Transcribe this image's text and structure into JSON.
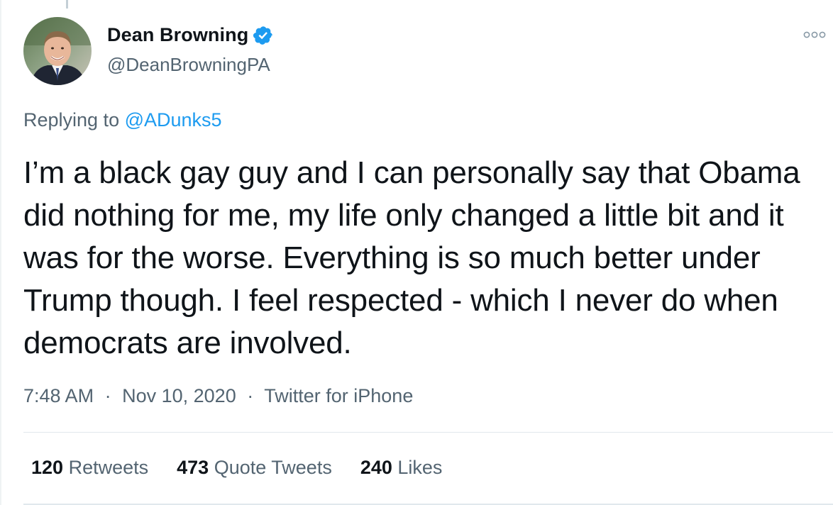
{
  "author": {
    "display_name": "Dean Browning",
    "handle": "@DeanBrowningPA",
    "verified": true,
    "avatar_icon": "profile-photo"
  },
  "reply": {
    "prefix": "Replying to ",
    "mention": "@ADunks5"
  },
  "tweet": {
    "text": "I’m a black gay guy and I can personally say that Obama did nothing for me, my life only changed a little bit and it was for the worse. Everything is so much better under Trump though. I feel respected - which I never do when democrats are involved."
  },
  "meta": {
    "time": "7:48 AM",
    "separator": "·",
    "date": "Nov 10, 2020",
    "source": "Twitter for iPhone"
  },
  "stats": {
    "retweets_count": "120",
    "retweets_label": "Retweets",
    "quotes_count": "473",
    "quotes_label": "Quote Tweets",
    "likes_count": "240",
    "likes_label": "Likes"
  },
  "colors": {
    "accent": "#1d9bf0",
    "text_primary": "#0f1419",
    "text_secondary": "#536471",
    "divider": "#e1e8ed"
  },
  "icons": {
    "verified": "verified-badge-icon",
    "more": "more-options-icon"
  }
}
